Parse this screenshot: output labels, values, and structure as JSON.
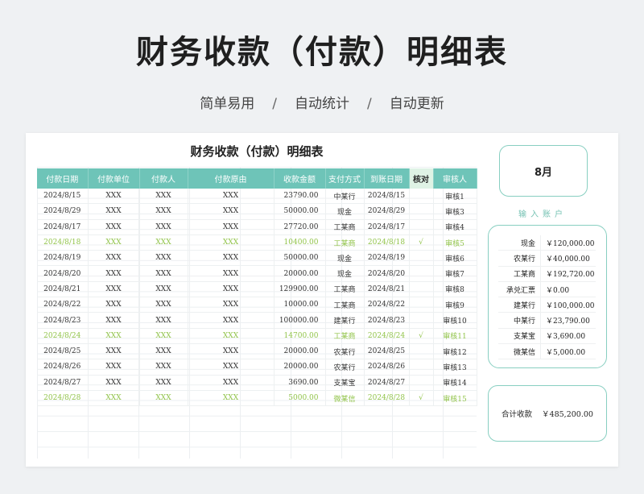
{
  "header": {
    "title": "财务收款（付款）明细表",
    "tags": [
      "简单易用",
      "自动统计",
      "自动更新"
    ],
    "separator": "/"
  },
  "sheet": {
    "title": "财务收款（付款）明细表",
    "columns": [
      "付款日期",
      "付款单位",
      "付款人",
      "付款原由",
      "收款金额",
      "支付方式",
      "到账日期",
      "核对",
      "审核人"
    ],
    "rows": [
      {
        "date": "2024/8/15",
        "unit": "XXX",
        "payer": "XXX",
        "reason": "XXX",
        "amount": "23790.00",
        "method": "中某行",
        "arrive": "2024/8/15",
        "check": "",
        "reviewer": "审核1",
        "verified": false
      },
      {
        "date": "2024/8/29",
        "unit": "XXX",
        "payer": "XXX",
        "reason": "XXX",
        "amount": "50000.00",
        "method": "现金",
        "arrive": "2024/8/29",
        "check": "",
        "reviewer": "审核3",
        "verified": false
      },
      {
        "date": "2024/8/17",
        "unit": "XXX",
        "payer": "XXX",
        "reason": "XXX",
        "amount": "27720.00",
        "method": "工某商",
        "arrive": "2024/8/17",
        "check": "",
        "reviewer": "审核4",
        "verified": false
      },
      {
        "date": "2024/8/18",
        "unit": "XXX",
        "payer": "XXX",
        "reason": "XXX",
        "amount": "10400.00",
        "method": "工某商",
        "arrive": "2024/8/18",
        "check": "√",
        "reviewer": "审核5",
        "verified": true
      },
      {
        "date": "2024/8/19",
        "unit": "XXX",
        "payer": "XXX",
        "reason": "XXX",
        "amount": "50000.00",
        "method": "现金",
        "arrive": "2024/8/19",
        "check": "",
        "reviewer": "审核6",
        "verified": false
      },
      {
        "date": "2024/8/20",
        "unit": "XXX",
        "payer": "XXX",
        "reason": "XXX",
        "amount": "20000.00",
        "method": "现金",
        "arrive": "2024/8/20",
        "check": "",
        "reviewer": "审核7",
        "verified": false
      },
      {
        "date": "2024/8/21",
        "unit": "XXX",
        "payer": "XXX",
        "reason": "XXX",
        "amount": "129900.00",
        "method": "工某商",
        "arrive": "2024/8/21",
        "check": "",
        "reviewer": "审核8",
        "verified": false
      },
      {
        "date": "2024/8/22",
        "unit": "XXX",
        "payer": "XXX",
        "reason": "XXX",
        "amount": "10000.00",
        "method": "工某商",
        "arrive": "2024/8/22",
        "check": "",
        "reviewer": "审核9",
        "verified": false
      },
      {
        "date": "2024/8/23",
        "unit": "XXX",
        "payer": "XXX",
        "reason": "XXX",
        "amount": "100000.00",
        "method": "建某行",
        "arrive": "2024/8/23",
        "check": "",
        "reviewer": "审核10",
        "verified": false
      },
      {
        "date": "2024/8/24",
        "unit": "XXX",
        "payer": "XXX",
        "reason": "XXX",
        "amount": "14700.00",
        "method": "工某商",
        "arrive": "2024/8/24",
        "check": "√",
        "reviewer": "审核11",
        "verified": true
      },
      {
        "date": "2024/8/25",
        "unit": "XXX",
        "payer": "XXX",
        "reason": "XXX",
        "amount": "20000.00",
        "method": "农某行",
        "arrive": "2024/8/25",
        "check": "",
        "reviewer": "审核12",
        "verified": false
      },
      {
        "date": "2024/8/26",
        "unit": "XXX",
        "payer": "XXX",
        "reason": "XXX",
        "amount": "20000.00",
        "method": "农某行",
        "arrive": "2024/8/26",
        "check": "",
        "reviewer": "审核13",
        "verified": false
      },
      {
        "date": "2024/8/27",
        "unit": "XXX",
        "payer": "XXX",
        "reason": "XXX",
        "amount": "3690.00",
        "method": "支某宝",
        "arrive": "2024/8/27",
        "check": "",
        "reviewer": "审核14",
        "verified": false
      },
      {
        "date": "2024/8/28",
        "unit": "XXX",
        "payer": "XXX",
        "reason": "XXX",
        "amount": "5000.00",
        "method": "微某信",
        "arrive": "2024/8/28",
        "check": "√",
        "reviewer": "审核15",
        "verified": true
      }
    ]
  },
  "summary": {
    "month": "8月",
    "account_label": "输入账户",
    "accounts": [
      {
        "name": "现金",
        "amount": "￥120,000.00"
      },
      {
        "name": "农某行",
        "amount": "￥40,000.00"
      },
      {
        "name": "工某商",
        "amount": "￥192,720.00"
      },
      {
        "name": "承兑汇票",
        "amount": "￥0.00"
      },
      {
        "name": "建某行",
        "amount": "￥100,000.00"
      },
      {
        "name": "中某行",
        "amount": "￥23,790.00"
      },
      {
        "name": "支某宝",
        "amount": "￥3,690.00"
      },
      {
        "name": "微某信",
        "amount": "￥5,000.00"
      }
    ],
    "total_label": "合计收款",
    "total_amount": "￥485,200.00"
  }
}
